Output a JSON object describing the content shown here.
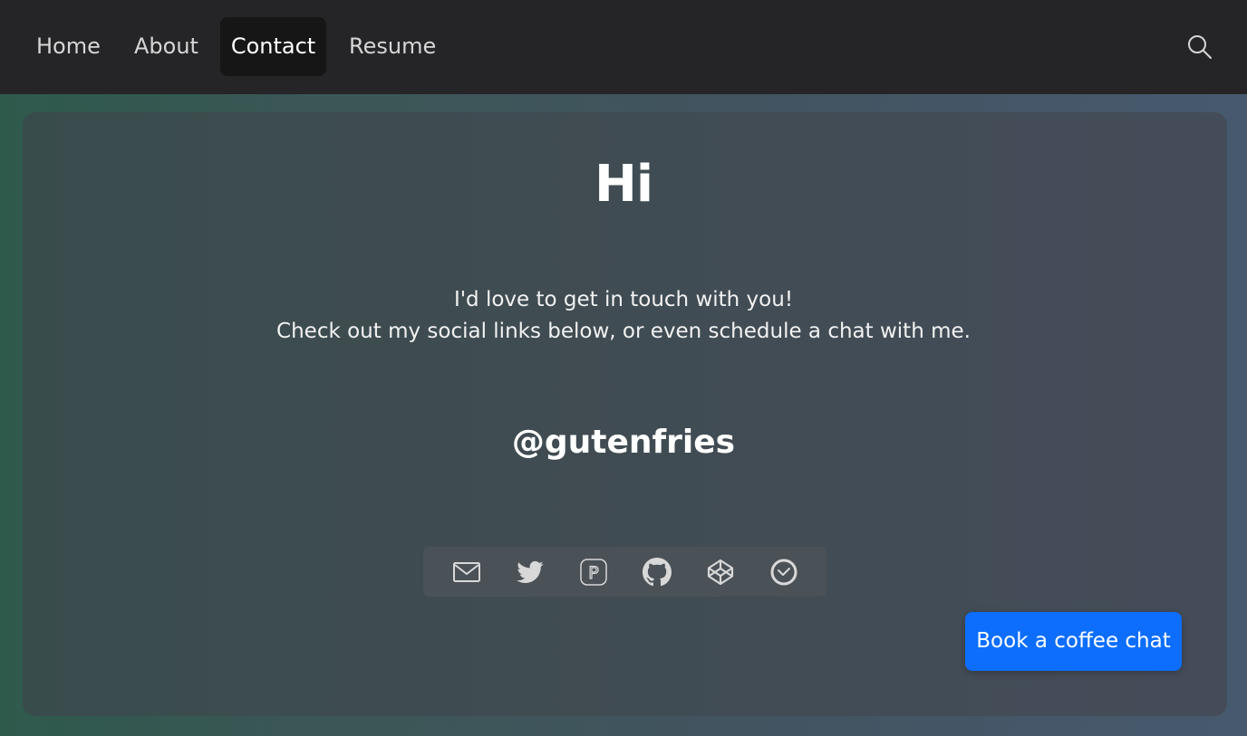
{
  "nav": {
    "items": [
      {
        "label": "Home"
      },
      {
        "label": "About"
      },
      {
        "label": "Contact",
        "active": true
      },
      {
        "label": "Resume"
      }
    ],
    "search_icon": "search-icon"
  },
  "main": {
    "title": "Hi",
    "intro_line_1": "I'd love to get in touch with you!",
    "intro_line_2": "Check out my social links below, or even schedule a chat with me.",
    "handle": "@gutenfries",
    "social_icons": [
      "mail-icon",
      "twitter-icon",
      "polywork-icon",
      "github-icon",
      "codepen-icon",
      "calendar-check-icon"
    ],
    "book_button_label": "Book a coffee chat"
  },
  "colors": {
    "navbar_bg": "#252527",
    "active_tab_bg": "#161617",
    "button_primary": "#0d6efd",
    "text": "#ffffff"
  }
}
